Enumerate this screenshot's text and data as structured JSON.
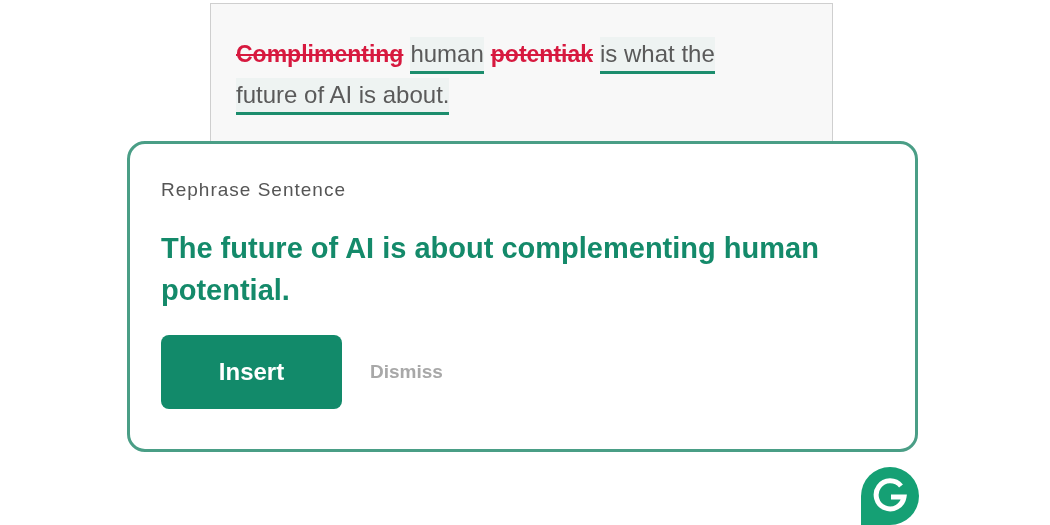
{
  "document": {
    "lines": [
      [
        {
          "text": "Complimenting",
          "kind": "deleted"
        },
        {
          "text": "human",
          "kind": "suggested"
        },
        {
          "text": "potentiak",
          "kind": "deleted"
        },
        {
          "text": "is what the",
          "kind": "suggested"
        }
      ],
      [
        {
          "text": "future of AI is about.",
          "kind": "suggested"
        }
      ]
    ]
  },
  "card": {
    "label": "Rephrase Sentence",
    "suggestion": "The future of AI is about complementing human potential.",
    "buttons": [
      {
        "label": "Insert",
        "kind": "primary"
      },
      {
        "label": "Dismiss",
        "kind": "text"
      }
    ]
  }
}
